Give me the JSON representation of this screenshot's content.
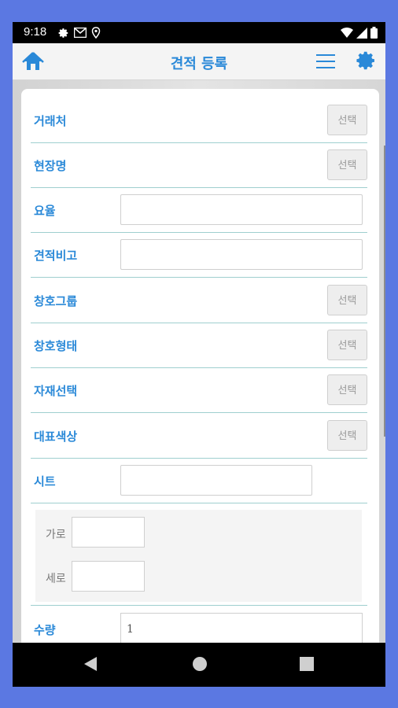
{
  "status_bar": {
    "time": "9:18",
    "left_icons": [
      "gear-icon",
      "gmail-icon",
      "location-icon"
    ],
    "right_icons": [
      "wifi-icon",
      "signal-icon",
      "battery-icon"
    ]
  },
  "app_bar": {
    "title": "견적 등록",
    "home_icon": "home-icon",
    "menu_icon": "menu-icon",
    "settings_icon": "gear-icon",
    "accent_color": "#2a89d8"
  },
  "form": {
    "select_label": "선택",
    "rows": [
      {
        "label": "거래처",
        "type": "select"
      },
      {
        "label": "현장명",
        "type": "select"
      },
      {
        "label": "요율",
        "type": "input",
        "value": ""
      },
      {
        "label": "견적비고",
        "type": "input",
        "value": ""
      },
      {
        "label": "창호그룹",
        "type": "select"
      },
      {
        "label": "창호형태",
        "type": "select"
      },
      {
        "label": "자재선택",
        "type": "select"
      },
      {
        "label": "대표색상",
        "type": "select"
      },
      {
        "label": "시트",
        "type": "input",
        "value": ""
      }
    ],
    "size": {
      "width_label": "가로",
      "width_value": "",
      "height_label": "세로",
      "height_value": ""
    },
    "quantity": {
      "label": "수량",
      "value": "1"
    }
  },
  "nav_bar": {
    "icons": [
      "back-icon",
      "home-circle-icon",
      "recents-icon"
    ]
  }
}
